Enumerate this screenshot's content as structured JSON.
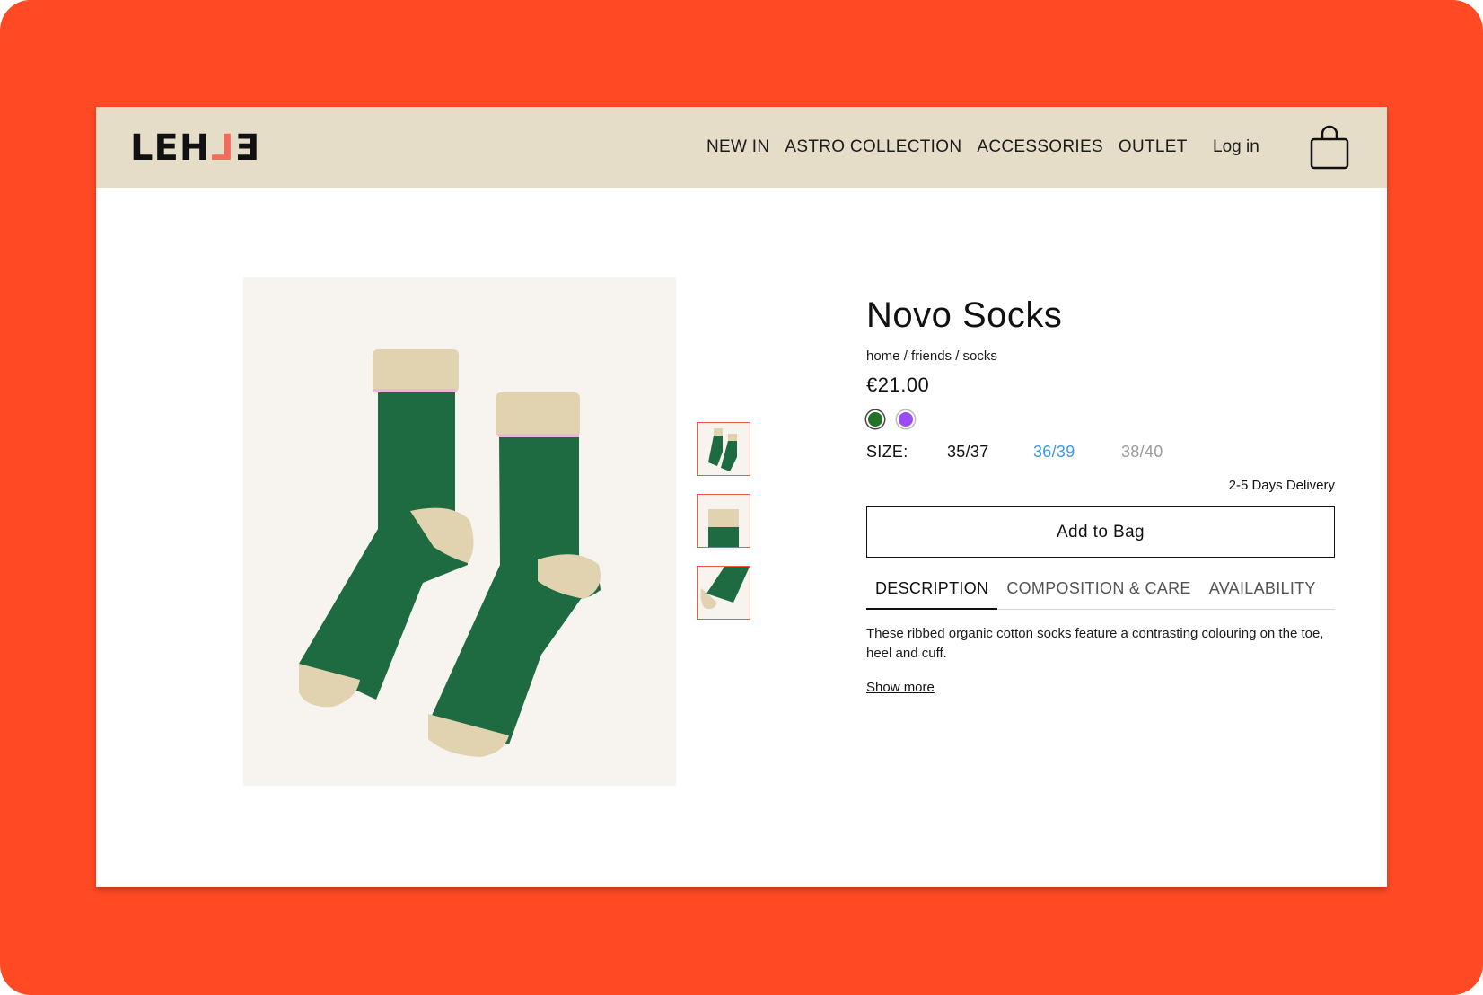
{
  "header": {
    "logo": {
      "letters": [
        "L",
        "E",
        "H",
        "L",
        "E"
      ],
      "colors": [
        "#111111",
        "#111111",
        "#111111",
        "#f36b5a",
        "#111111"
      ]
    },
    "nav": [
      "NEW IN",
      "ASTRO COLLECTION",
      "ACCESSORIES",
      "OUTLET"
    ],
    "login_label": "Log in",
    "bag_icon": "shopping-bag-icon"
  },
  "product": {
    "title": "Novo Socks",
    "breadcrumb": "home / friends / socks",
    "price": "€21.00",
    "colors": [
      {
        "name": "green",
        "hex": "#247226",
        "selected": true
      },
      {
        "name": "purple",
        "hex": "#9b4df5",
        "selected": false
      }
    ],
    "size_label": "SIZE:",
    "sizes": [
      {
        "label": "35/37",
        "state": "default",
        "color": "#111111"
      },
      {
        "label": "36/39",
        "state": "selected",
        "color": "#3a9ae3"
      },
      {
        "label": "38/40",
        "state": "unavailable",
        "color": "#9a9a9a"
      }
    ],
    "delivery": "2-5 Days Delivery",
    "add_to_bag": "Add to Bag",
    "tabs": [
      "DESCRIPTION",
      "COMPOSITION & CARE",
      "AVAILABILITY"
    ],
    "active_tab": 0,
    "description": "These ribbed organic cotton socks feature a contrasting colouring on the toe, heel and cuff.",
    "show_more": "Show more"
  },
  "gallery": {
    "thumbnail_count": 3,
    "active_thumbnail": 0
  },
  "theme": {
    "frame_bg": "#ff4a24",
    "header_bg": "#e5ddc8",
    "sock_green": "#1e6a41",
    "sock_beige": "#e2d3b0",
    "cuff_stripe": "#e8b8d6"
  }
}
